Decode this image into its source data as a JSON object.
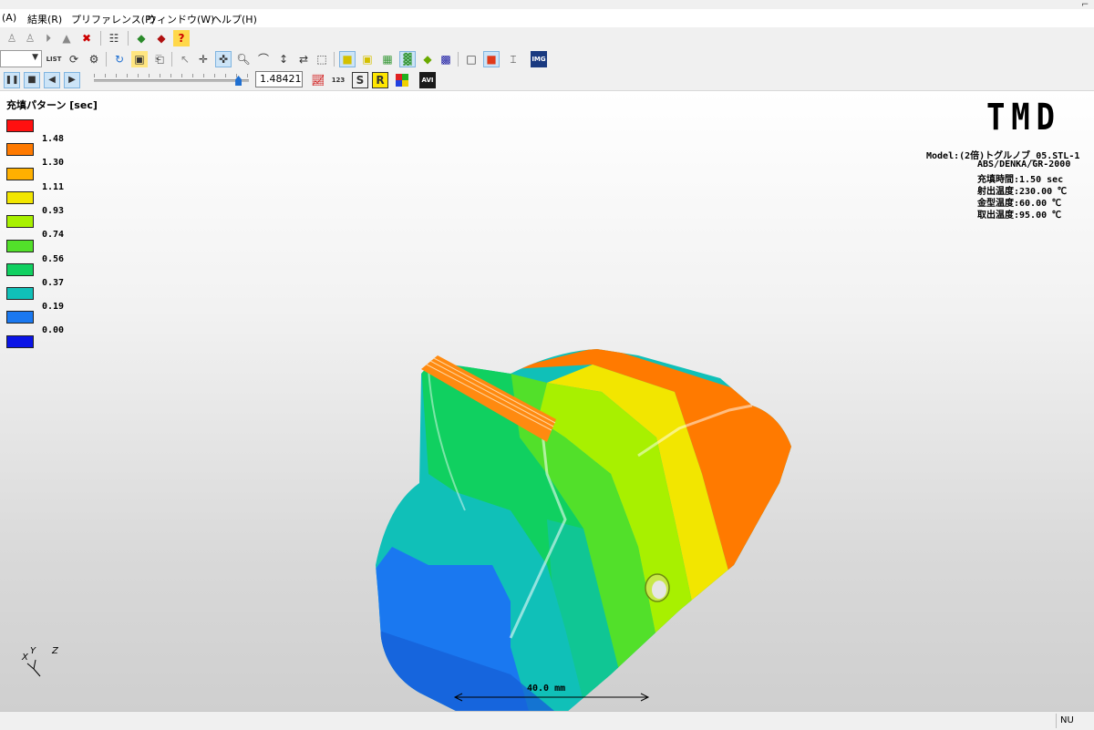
{
  "menu": {
    "items": [
      "(A)",
      "結果(R)",
      "プリファレンス(P)",
      "ウィンドウ(W)",
      "ヘルプ(H)"
    ]
  },
  "toolbar": {
    "list_label": "LIST",
    "img_label": "IMG",
    "avi_label": "AVI",
    "s_label": "S",
    "r_label": "R",
    "num_label": "123"
  },
  "playback": {
    "time_value": "1.48421",
    "slider_fraction": 0.93
  },
  "legend": {
    "title": "充填パターン [sec]",
    "colors": [
      "#ff1010",
      "#ff7a00",
      "#ffb000",
      "#f2e600",
      "#a8f000",
      "#52e02a",
      "#10d060",
      "#10c0b8",
      "#1a78f0",
      "#0a14e6"
    ],
    "labels": [
      "1.48",
      "1.30",
      "1.11",
      "0.93",
      "0.74",
      "0.56",
      "0.37",
      "0.19",
      "0.00"
    ]
  },
  "logo": "TMD",
  "model_info": {
    "model": "Model:(2倍)トグルノブ_05.STL-1",
    "material": "ABS/DENKA/GR-2000",
    "fill_time": "充填時間:1.50 sec",
    "injection_temp": "射出温度:230.00 ℃",
    "mold_temp": "金型温度:60.00 ℃",
    "ejection_temp": "取出温度:95.00 ℃"
  },
  "axes": {
    "x": "X",
    "y": "Y",
    "z": "Z"
  },
  "scale": {
    "label": "40.0 mm"
  },
  "status": {
    "cell": "NU"
  }
}
